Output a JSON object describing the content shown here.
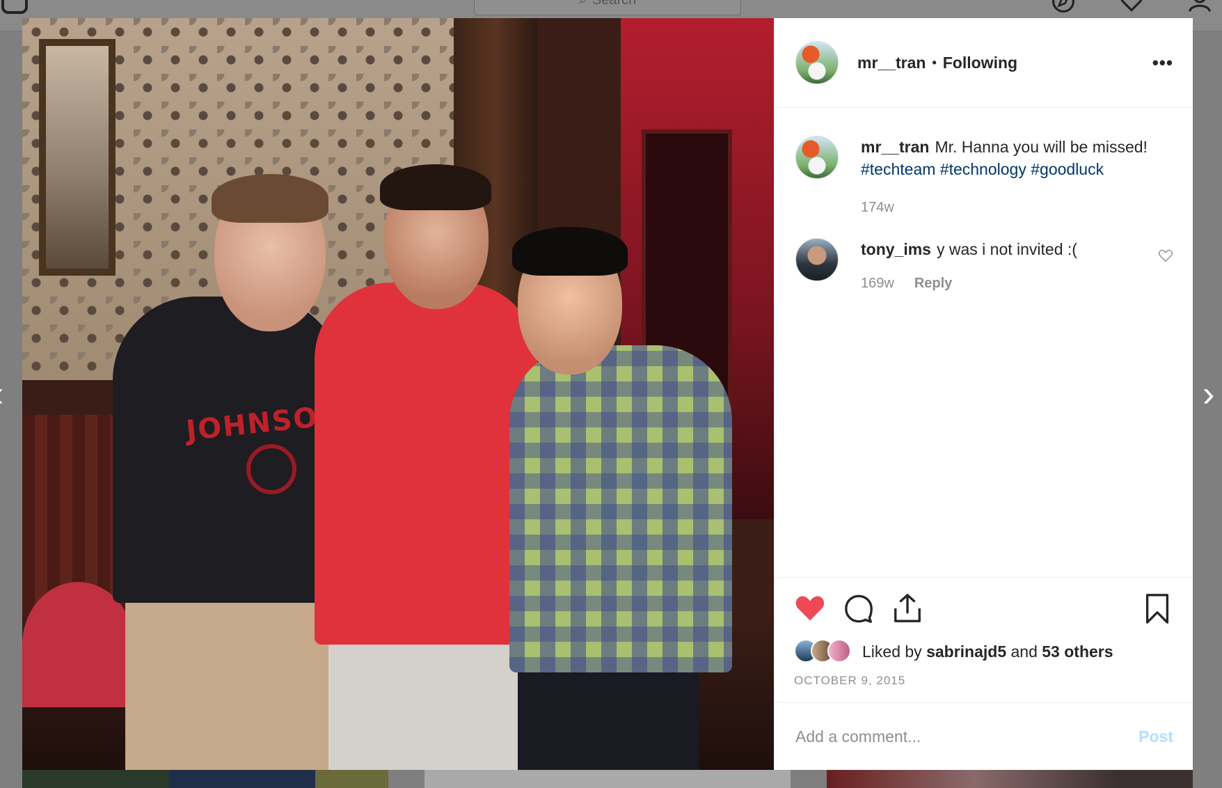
{
  "nav": {
    "search_placeholder": "Search"
  },
  "post": {
    "username": "mr__tran",
    "separator": "•",
    "follow_status": "Following",
    "more_label": "•••"
  },
  "caption": {
    "username": "mr__tran",
    "text_before": "Mr. Hanna you will be missed!",
    "hashtags": [
      "#techteam",
      "#technology",
      "#goodluck"
    ],
    "age": "174w"
  },
  "comments": [
    {
      "username": "tony_ims",
      "text": "y was i not invited :(",
      "age": "169w",
      "reply_label": "Reply"
    }
  ],
  "photo": {
    "shirt_text": "JOHNSON"
  },
  "likes": {
    "prefix": "Liked by",
    "user": "sabrinajd5",
    "conjunction": "and",
    "others": "53 others"
  },
  "date": "OCTOBER 9, 2015",
  "composer": {
    "placeholder": "Add a comment...",
    "post_label": "Post"
  },
  "icons": {
    "like": "heart-filled-icon",
    "comment": "comment-bubble-icon",
    "share": "share-upload-icon",
    "save": "bookmark-icon",
    "comment_like": "heart-outline-icon",
    "prev": "chevron-left-icon",
    "next": "chevron-right-icon"
  },
  "colors": {
    "heart": "#ed4956",
    "hashtag": "#00376b",
    "post_disabled": "#b2dffc",
    "muted": "#8e8e8e",
    "text": "#262626"
  }
}
